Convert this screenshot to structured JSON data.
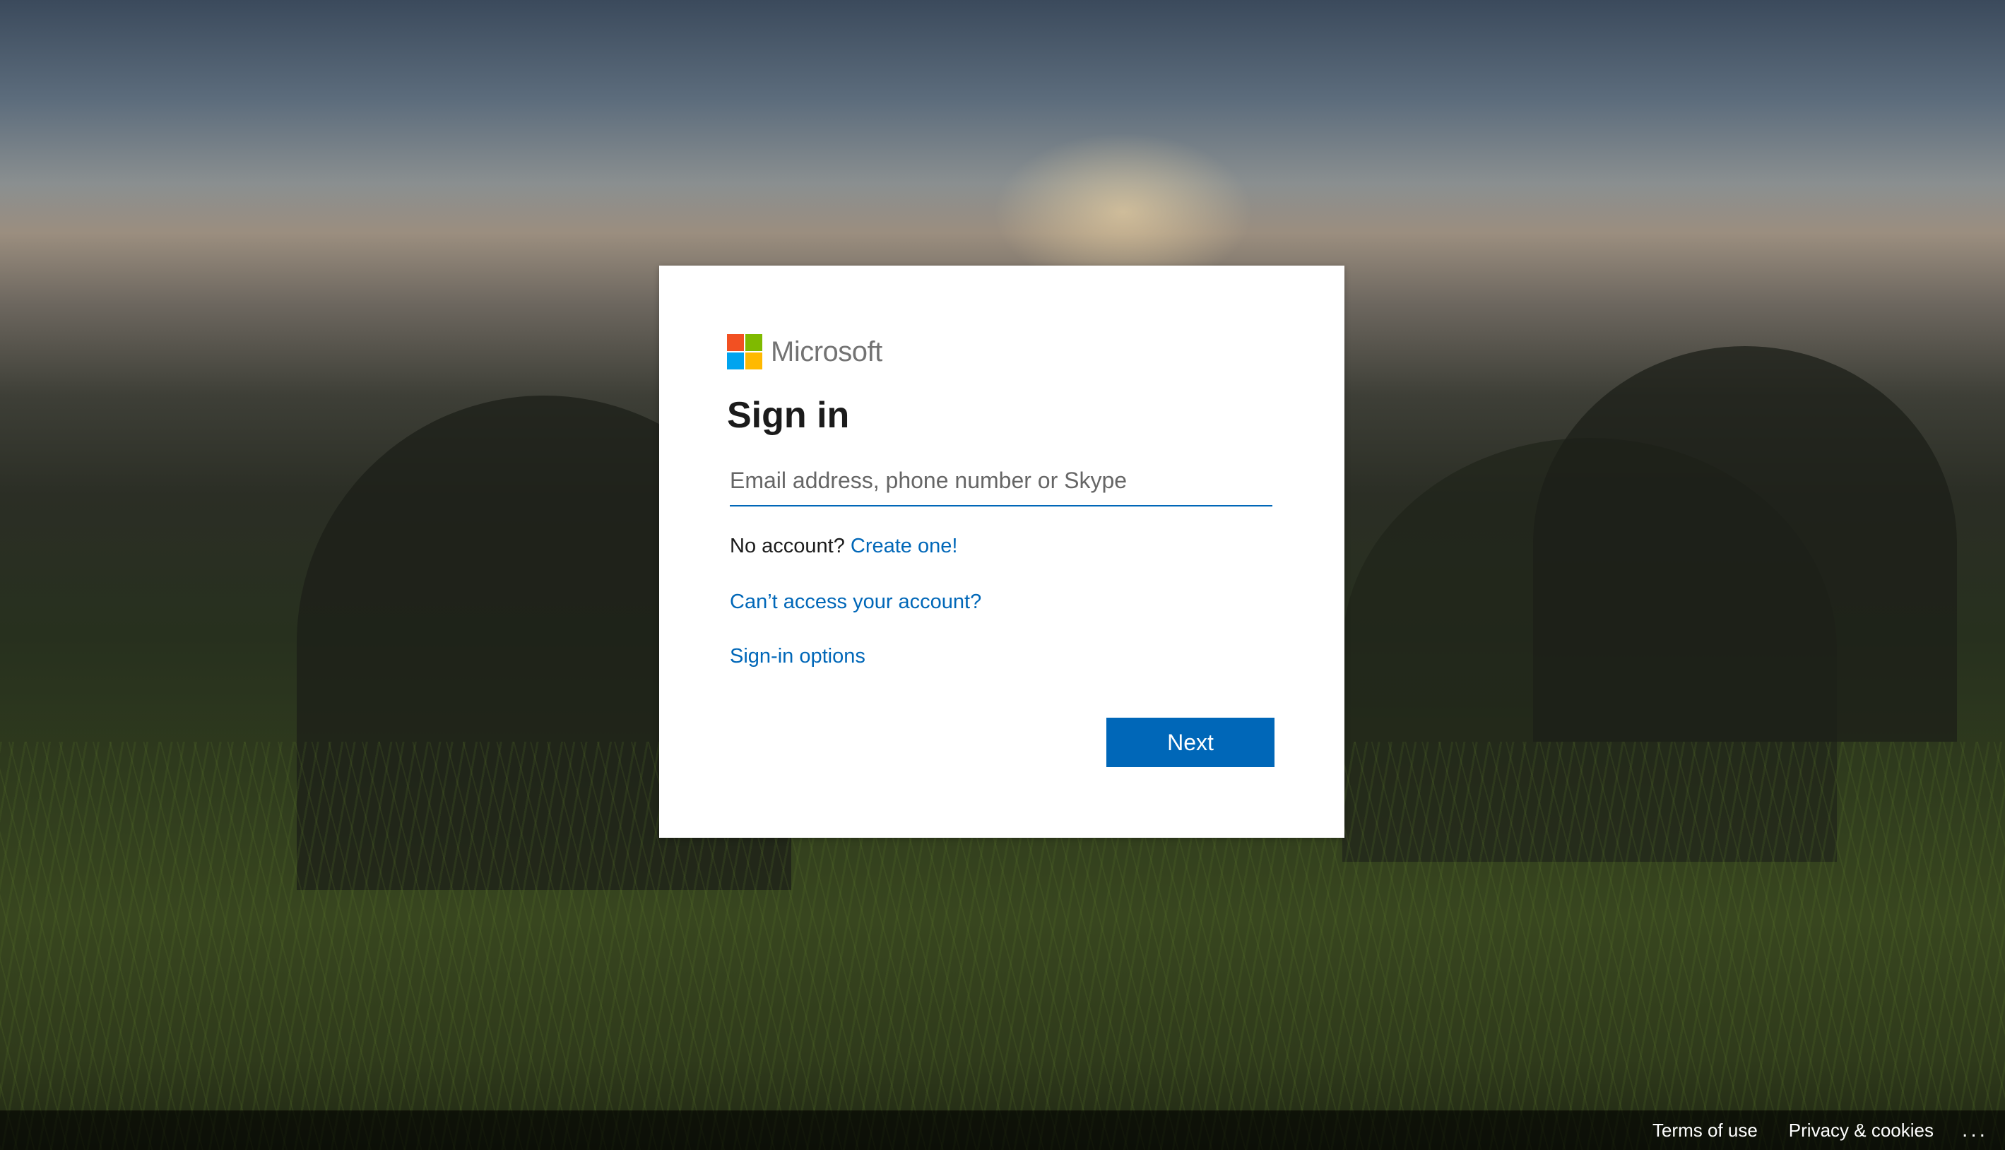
{
  "brand": {
    "name": "Microsoft",
    "logo_colors": [
      "#f25022",
      "#7fba00",
      "#00a4ef",
      "#ffb900"
    ]
  },
  "signin": {
    "title": "Sign in",
    "email_placeholder": "Email address, phone number or Skype",
    "email_value": "",
    "no_account_text": "No account?",
    "create_link": "Create one!",
    "cant_access_link": "Can’t access your account?",
    "signin_options_link": "Sign-in options",
    "next_label": "Next"
  },
  "footer": {
    "terms": "Terms of use",
    "privacy": "Privacy & cookies",
    "more": "..."
  },
  "colors": {
    "accent": "#0067b8",
    "text": "#1b1b1b",
    "brand_gray": "#737373"
  }
}
